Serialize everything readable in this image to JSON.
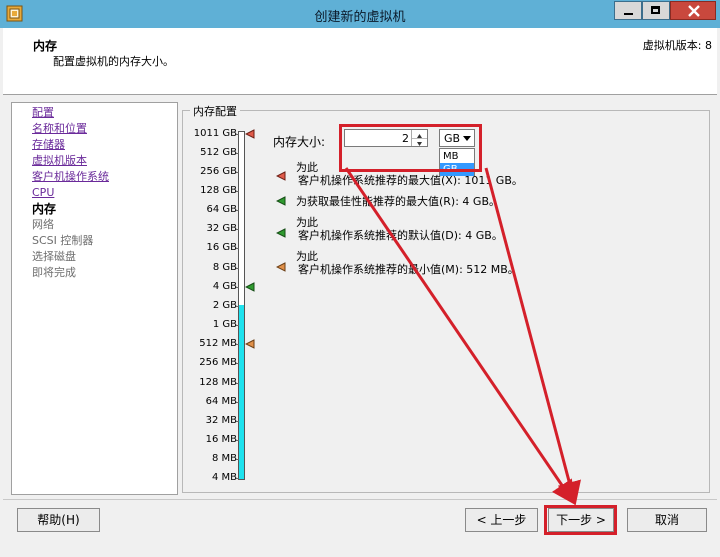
{
  "window": {
    "title": "创建新的虚拟机",
    "titlebar_color": "#5fb0d6"
  },
  "header": {
    "title": "内存",
    "subtitle": "配置虚拟机的内存大小。",
    "version": "虚拟机版本: 8"
  },
  "nav": {
    "items": [
      {
        "label": "配置",
        "state": "link"
      },
      {
        "label": "名称和位置",
        "state": "link"
      },
      {
        "label": "存储器",
        "state": "link"
      },
      {
        "label": "虚拟机版本",
        "state": "link"
      },
      {
        "label": "客户机操作系统",
        "state": "link"
      },
      {
        "label": "CPU",
        "state": "link"
      },
      {
        "label": "内存",
        "state": "current"
      },
      {
        "label": "网络",
        "state": "future"
      },
      {
        "label": "SCSI 控制器",
        "state": "future"
      },
      {
        "label": "选择磁盘",
        "state": "future"
      },
      {
        "label": "即将完成",
        "state": "future"
      }
    ]
  },
  "memory": {
    "group_label": "内存配置",
    "scale_labels": [
      "1011 GB",
      "512 GB",
      "256 GB",
      "128 GB",
      "64 GB",
      "32 GB",
      "16 GB",
      "8 GB",
      "4 GB",
      "2 GB",
      "1 GB",
      "512 MB",
      "256 MB",
      "128 MB",
      "64 MB",
      "32 MB",
      "16 MB",
      "8 MB",
      "4 MB"
    ],
    "filled_up_to": "2 GB",
    "size_label": "内存大小:",
    "size_value": "2",
    "unit_value": "GB",
    "unit_options": [
      "MB",
      "GB"
    ],
    "unit_selected": "GB",
    "recommendations": [
      {
        "line1": "为此",
        "line2": "客户机操作系统推荐的最大值(X): 1011 GB。",
        "marker_color": "#e05a4a"
      },
      {
        "line1": "",
        "line2": "为获取最佳性能推荐的最大值(R): 4 GB。",
        "marker_color": "#2f9a2f"
      },
      {
        "line1": "为此",
        "line2": "客户机操作系统推荐的默认值(D): 4 GB。",
        "marker_color": "#2f9a2f"
      },
      {
        "line1": "为此",
        "line2": "客户机操作系统推荐的最小值(M): 512 MB。",
        "marker_color": "#e0904a"
      }
    ]
  },
  "footer": {
    "help_label": "帮助(H)",
    "back_label": "< 上一步",
    "next_label": "下一步 >",
    "cancel_label": "取消"
  },
  "annotation": {
    "highlight_color": "#d4202a"
  }
}
